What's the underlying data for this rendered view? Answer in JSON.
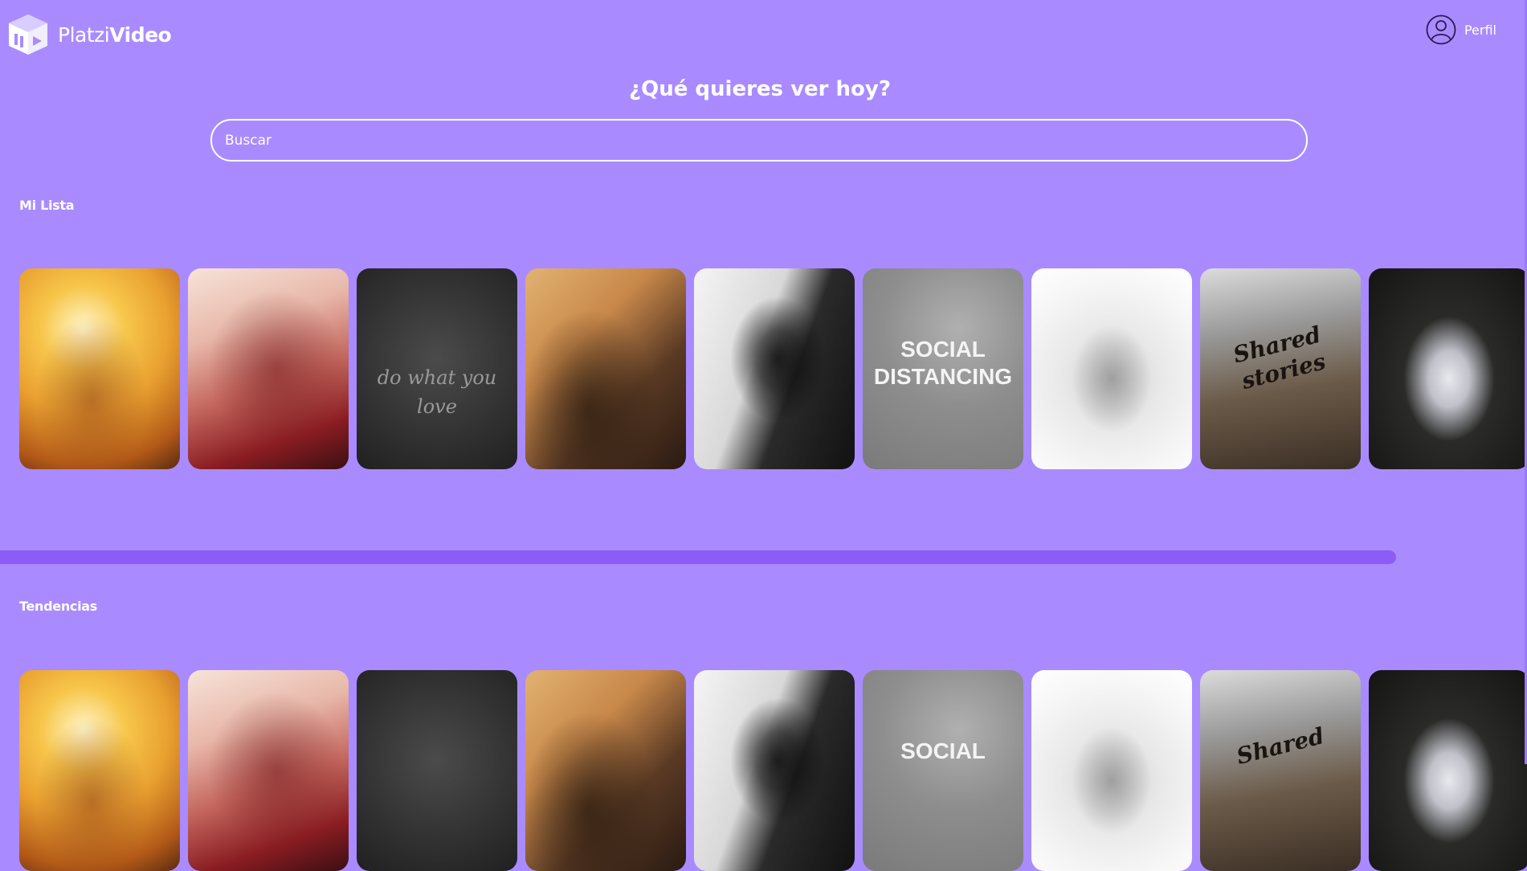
{
  "header": {
    "logo_text_light": "Platzi",
    "logo_text_bold": "Video",
    "profile_label": "Perfil"
  },
  "hero": {
    "title": "¿Qué quieres ver hoy?"
  },
  "search": {
    "placeholder": "Buscar"
  },
  "sections": [
    {
      "title": "Mi Lista",
      "cards": [
        {
          "style": "c1",
          "text": ""
        },
        {
          "style": "c2",
          "text": ""
        },
        {
          "style": "c3",
          "text": "do what you love"
        },
        {
          "style": "c4",
          "text": ""
        },
        {
          "style": "c5",
          "text": ""
        },
        {
          "style": "c6",
          "text": "SOCIAL DISTANCING"
        },
        {
          "style": "c7",
          "text": ""
        },
        {
          "style": "c8",
          "text": "Shared stories"
        },
        {
          "style": "c9",
          "text": ""
        }
      ]
    },
    {
      "title": "Tendencias",
      "cards": [
        {
          "style": "c1",
          "text": ""
        },
        {
          "style": "c2",
          "text": ""
        },
        {
          "style": "c3",
          "text": ""
        },
        {
          "style": "c4",
          "text": ""
        },
        {
          "style": "c5",
          "text": ""
        },
        {
          "style": "c6",
          "text": "SOCIAL"
        },
        {
          "style": "c7",
          "text": ""
        },
        {
          "style": "c8",
          "text": "Shared"
        },
        {
          "style": "c9",
          "text": ""
        }
      ]
    }
  ],
  "colors": {
    "background": "#a98bff",
    "scrollbar": "#8b5cf6",
    "text": "#ffffff"
  }
}
